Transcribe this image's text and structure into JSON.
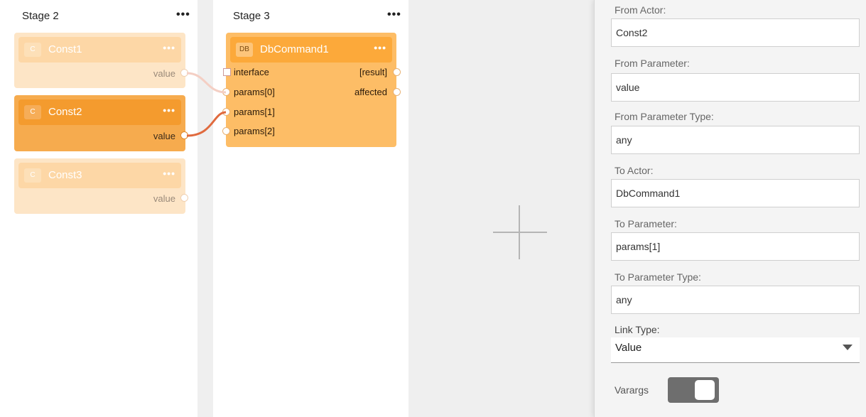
{
  "stages": [
    {
      "title": "Stage 2",
      "menu": "•••",
      "actors": [
        {
          "badge": "C",
          "name": "Const1",
          "menu": "•••",
          "output": "value",
          "state": "faded"
        },
        {
          "badge": "C",
          "name": "Const2",
          "menu": "•••",
          "output": "value",
          "state": "selected"
        },
        {
          "badge": "C",
          "name": "Const3",
          "menu": "•••",
          "output": "value",
          "state": "faded"
        }
      ]
    },
    {
      "title": "Stage 3",
      "menu": "•••",
      "actors": [
        {
          "badge": "DB",
          "name": "DbCommand1",
          "menu": "•••",
          "inputs": [
            "interface",
            "params[0]",
            "params[1]",
            "params[2]"
          ],
          "outputs": [
            "[result]",
            "affected"
          ]
        }
      ]
    }
  ],
  "canvas": {
    "add_icon": "plus-icon"
  },
  "panel": {
    "from_actor_label": "From Actor:",
    "from_actor_value": "Const2",
    "from_param_label": "From Parameter:",
    "from_param_value": "value",
    "from_param_type_label": "From Parameter Type:",
    "from_param_type_value": "any",
    "to_actor_label": "To Actor:",
    "to_actor_value": "DbCommand1",
    "to_param_label": "To Parameter:",
    "to_param_value": "params[1]",
    "to_param_type_label": "To Parameter Type:",
    "to_param_type_value": "any",
    "link_type_label": "Link Type:",
    "link_type_value": "Value",
    "varargs_label": "Varargs",
    "varargs_on": true
  },
  "colors": {
    "actor_selected": "#f5a94a",
    "actor_header_selected": "#f39a2c",
    "actor_faded": "#fde2c0",
    "actor_header_faded": "#fdd5a3",
    "db_actor": "#fdbc63",
    "db_header": "#fca838",
    "link_active": "#e06a3e",
    "link_faded": "#f2c8bd"
  }
}
